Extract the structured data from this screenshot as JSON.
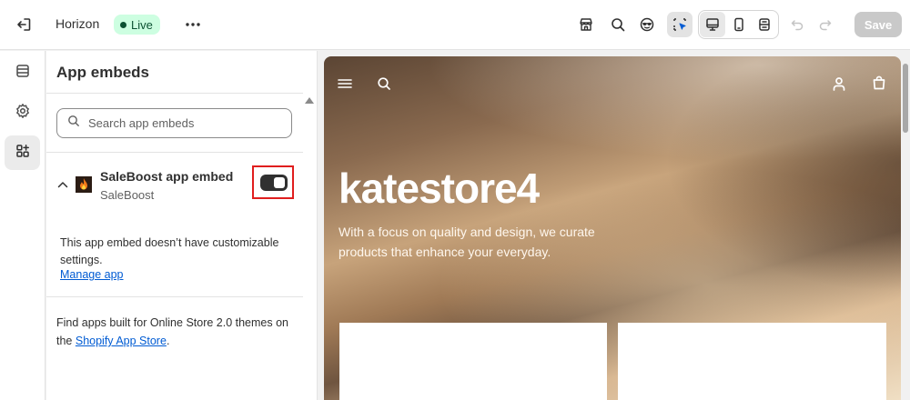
{
  "topbar": {
    "theme_name": "Horizon",
    "live_badge": "Live",
    "save_label": "Save"
  },
  "icons": {
    "exit": "exit-icon",
    "more": "more-horizontal-icon",
    "store": "store-icon",
    "search": "search-icon",
    "ai": "sidekick-icon",
    "inspector": "inspector-icon",
    "desktop": "desktop-icon",
    "mobile": "mobile-icon",
    "fullscreen": "fullscreen-icon",
    "undo": "undo-icon",
    "redo": "redo-icon"
  },
  "rail": {
    "items": [
      {
        "name": "sections",
        "icon": "sections-icon"
      },
      {
        "name": "settings",
        "icon": "gear-icon"
      },
      {
        "name": "app-embeds",
        "icon": "apps-icon",
        "active": true
      }
    ]
  },
  "panel": {
    "title": "App embeds",
    "search_placeholder": "Search app embeds",
    "embed": {
      "name": "SaleBoost app embed",
      "vendor": "SaleBoost",
      "enabled": true,
      "message": "This app embed doesn’t have customizable settings.",
      "manage_link": "Manage app"
    },
    "footer": {
      "prefix": "Find apps built for Online Store 2.0 themes on the ",
      "link": "Shopify App Store",
      "suffix": "."
    }
  },
  "preview": {
    "store_name": "katestore4",
    "tagline": "With a focus on quality and design, we curate products that enhance your everyday."
  },
  "colors": {
    "accent_link": "#005bd3",
    "live_badge_bg": "#cdfee1",
    "highlight_border": "#e01e1e",
    "toggle_on": "#303030"
  }
}
